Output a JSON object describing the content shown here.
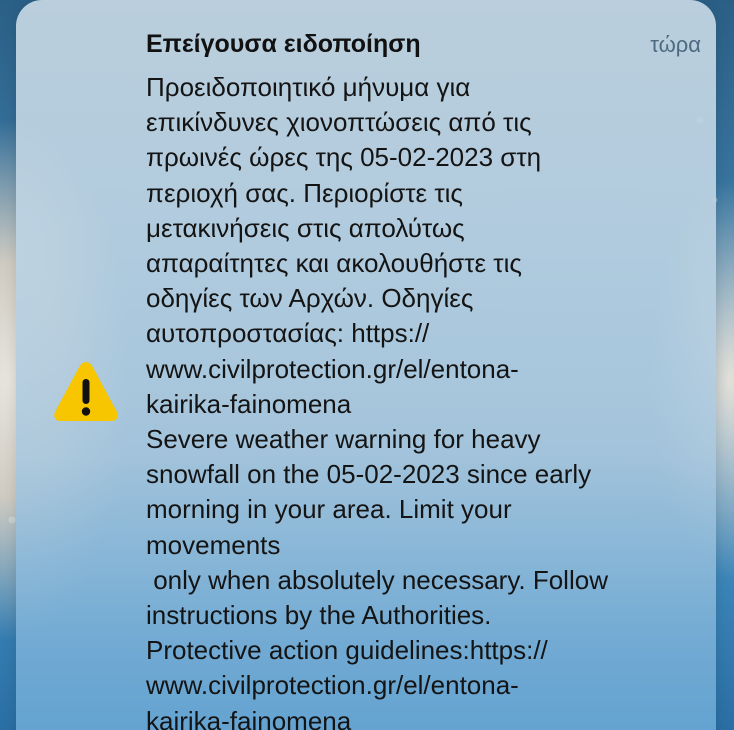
{
  "notification": {
    "title": "Επείγουσα ειδοποίηση",
    "timestamp": "τώρα",
    "icon": "warning-triangle-icon",
    "icon_color": "#F7C600",
    "message_lines": [
      "Προειδοποιητικό μήνυμα για",
      "επικίνδυνες χιονοπτώσεις από τις",
      "πρωινές ώρες της 05-02-2023 στη",
      "περιοχή σας. Περιορίστε τις",
      "μετακινήσεις στις απολύτως",
      "απαραίτητες και ακολουθήστε τις",
      "οδηγίες των Αρχών. Οδηγίες",
      "αυτοπροστασίας: https://",
      "www.civilprotection.gr/el/entona-",
      "kairika-fainomena",
      "Severe weather warning for heavy",
      "snowfall on the 05-02-2023 since early",
      "morning in your area. Limit your",
      "movements",
      " only when absolutely necessary. Follow",
      "instructions by the Authorities.",
      "Protective action guidelines:https://",
      "www.civilprotection.gr/el/entona-",
      "kairika-fainomena"
    ]
  }
}
